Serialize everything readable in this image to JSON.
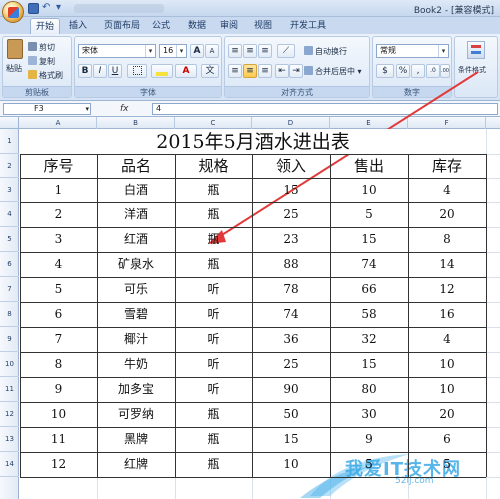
{
  "window": {
    "title": "Book2 - [兼容模式]"
  },
  "ribbon": {
    "tabs": [
      {
        "label": "开始",
        "active": true
      },
      {
        "label": "插入",
        "active": false
      },
      {
        "label": "页面布局",
        "active": false
      },
      {
        "label": "公式",
        "active": false
      },
      {
        "label": "数据",
        "active": false
      },
      {
        "label": "审阅",
        "active": false
      },
      {
        "label": "视图",
        "active": false
      },
      {
        "label": "开发工具",
        "active": false
      }
    ],
    "clipboard": {
      "paste": "粘贴",
      "cut": "剪切",
      "copy": "复制",
      "format_painter": "格式刷",
      "label": "剪贴板"
    },
    "font": {
      "name": "宋体",
      "size": "16",
      "grow": "A",
      "shrink": "A",
      "bold": "B",
      "italic": "I",
      "underline": "U",
      "phonetic": "文",
      "label": "字体"
    },
    "alignment": {
      "wrap": "自动换行",
      "merge": "合并后居中",
      "label": "对齐方式"
    },
    "number": {
      "format": "常规",
      "currency": "$",
      "percent": "%",
      "comma": ",",
      "inc_dec": ".0",
      "dec_dec": ".00",
      "label": "数字"
    },
    "styles": {
      "conditional": "条件格式"
    }
  },
  "formula_bar": {
    "cell_ref": "F3",
    "fx": "fx",
    "value": "4"
  },
  "sheet": {
    "columns": [
      "A",
      "B",
      "C",
      "D",
      "E",
      "F"
    ],
    "rows": [
      "1",
      "2",
      "3",
      "4",
      "5",
      "6",
      "7",
      "8",
      "9",
      "10",
      "11",
      "12",
      "13",
      "14"
    ],
    "title": "2015年5月酒水进出表",
    "headers": [
      "序号",
      "品名",
      "规格",
      "领入",
      "售出",
      "库存"
    ],
    "records": [
      [
        "1",
        "白酒",
        "瓶",
        "15",
        "10",
        "4"
      ],
      [
        "2",
        "洋酒",
        "瓶",
        "25",
        "5",
        "20"
      ],
      [
        "3",
        "红酒",
        "瓶",
        "23",
        "15",
        "8"
      ],
      [
        "4",
        "矿泉水",
        "瓶",
        "88",
        "74",
        "14"
      ],
      [
        "5",
        "可乐",
        "听",
        "78",
        "66",
        "12"
      ],
      [
        "6",
        "雪碧",
        "听",
        "74",
        "58",
        "16"
      ],
      [
        "7",
        "椰汁",
        "听",
        "36",
        "32",
        "4"
      ],
      [
        "8",
        "牛奶",
        "听",
        "25",
        "15",
        "10"
      ],
      [
        "9",
        "加多宝",
        "听",
        "90",
        "80",
        "10"
      ],
      [
        "10",
        "可罗纳",
        "瓶",
        "50",
        "30",
        "20"
      ],
      [
        "11",
        "黑牌",
        "瓶",
        "15",
        "9",
        "6"
      ],
      [
        "12",
        "红牌",
        "瓶",
        "10",
        "5",
        "5"
      ]
    ]
  },
  "watermark": {
    "text": "我爱IT技术网",
    "sub": "52ij.com"
  },
  "colors": {
    "accent": "#e23a3a",
    "ribbon": "#d5e3f4",
    "watermark": "#3aa9e6"
  }
}
